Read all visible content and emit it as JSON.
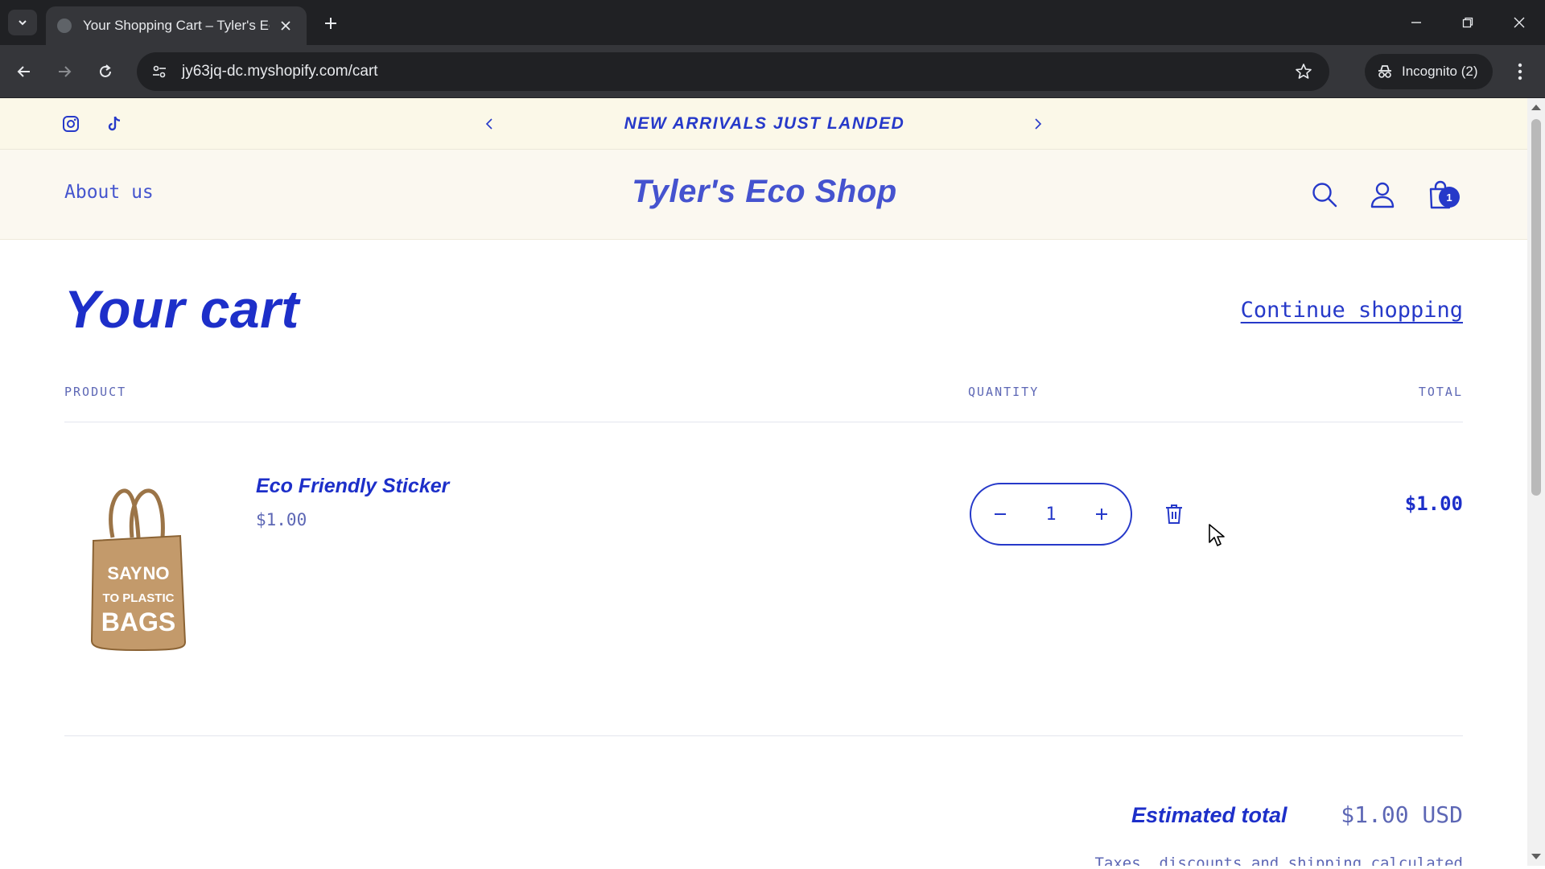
{
  "browser": {
    "tab_title": "Your Shopping Cart – Tyler's Eco",
    "url": "jy63jq-dc.myshopify.com/cart",
    "incognito_label": "Incognito (2)"
  },
  "announcement": {
    "text": "NEW ARRIVALS JUST LANDED"
  },
  "header": {
    "about_label": "About us",
    "logo": "Tyler's Eco Shop",
    "cart_count": "1"
  },
  "cart": {
    "title": "Your cart",
    "continue_label": "Continue shopping",
    "columns": {
      "product": "PRODUCT",
      "quantity": "QUANTITY",
      "total": "TOTAL"
    },
    "items": [
      {
        "name": "Eco Friendly Sticker",
        "price": "$1.00",
        "quantity": "1",
        "line_total": "$1.00",
        "image_text": [
          "SAY",
          "NO",
          "TO PLASTIC",
          "BAGS"
        ]
      }
    ],
    "estimated_label": "Estimated total",
    "estimated_value": "$1.00 USD",
    "tax_note": "Taxes, discounts and shipping calculated"
  },
  "colors": {
    "brand_blue": "#2639c9",
    "announcement_bg": "#fbf8e8",
    "header_bg": "#fbf8f0"
  }
}
